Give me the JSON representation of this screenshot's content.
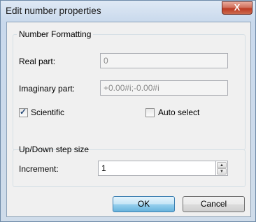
{
  "window": {
    "title": "Edit number properties",
    "close_glyph": "X"
  },
  "number_formatting": {
    "legend": "Number Formatting",
    "real_part_label": "Real part:",
    "real_part_value": "0",
    "imaginary_part_label": "Imaginary part:",
    "imaginary_part_value": "+0.00#i;-0.00#i",
    "scientific_label": "Scientific",
    "scientific_checked": true,
    "auto_select_label": "Auto select",
    "auto_select_checked": false
  },
  "step_size": {
    "legend": "Up/Down step size",
    "increment_label": "Increment:",
    "increment_value": "1"
  },
  "buttons": {
    "ok": "OK",
    "cancel": "Cancel"
  },
  "icons": {
    "close": "close-icon",
    "spin_up": "spin-up-icon",
    "spin_down": "spin-down-icon",
    "check": "check-icon"
  }
}
